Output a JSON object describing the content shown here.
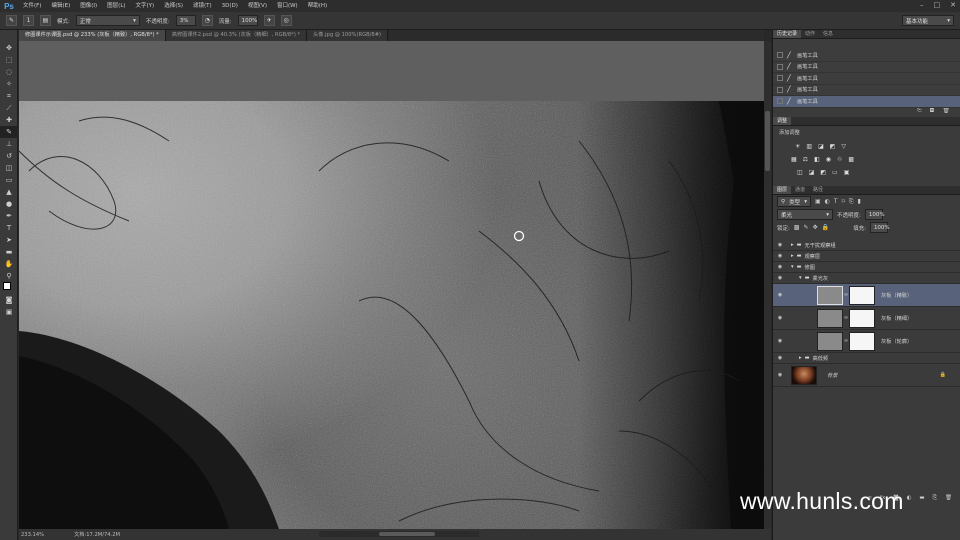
{
  "app": {
    "logo": "Ps"
  },
  "menubar": {
    "items": [
      "文件(F)",
      "编辑(E)",
      "图像(I)",
      "图层(L)",
      "文字(Y)",
      "选择(S)",
      "滤镜(T)",
      "3D(D)",
      "视图(V)",
      "窗口(W)",
      "帮助(H)"
    ]
  },
  "window_controls": {
    "minimize": "–",
    "maximize": "□",
    "close": "✕"
  },
  "options": {
    "brush_size": "1",
    "mode_label": "模式:",
    "mode_value": "正常",
    "opacity_label": "不透明度:",
    "opacity_value": "3%",
    "flow_label": "流量:",
    "flow_value": "100%",
    "workspace": "基本功能"
  },
  "doc_tabs": [
    "修图课件示课图.psd @ 233% (灰板（精致）, RGB/8*) *",
    "高修图课件2.psd @ 40.3% (灰板（精细）, RGB/8*) *",
    "头像.jpg @ 100%(RGB/8#)"
  ],
  "status": {
    "zoom": "233.14%",
    "doc_size": "文档:17.2M/74.2M"
  },
  "history": {
    "tabs": [
      "历史记录",
      "动作",
      "信息"
    ],
    "items": [
      "画笔工具",
      "画笔工具",
      "画笔工具",
      "画笔工具",
      "画笔工具"
    ]
  },
  "adjustments": {
    "tab": "调整",
    "add_label": "添加调整"
  },
  "layers": {
    "tabs": [
      "图层",
      "通道",
      "路径"
    ],
    "filter_kind": "类型",
    "blend_mode": "柔光",
    "opacity_label": "不透明度:",
    "opacity_value": "100%",
    "lock_label": "锁定:",
    "fill_label": "填充:",
    "fill_value": "100%",
    "rows": [
      {
        "name": "无干扰观察组",
        "kind": "group"
      },
      {
        "name": "观察层",
        "kind": "group"
      },
      {
        "name": "修图",
        "kind": "group-open"
      },
      {
        "name": "柔光灰",
        "kind": "group-open"
      },
      {
        "name": "灰板（精致）",
        "kind": "layer"
      },
      {
        "name": "灰板（精细）",
        "kind": "layer"
      },
      {
        "name": "灰板（轮廓）",
        "kind": "layer"
      },
      {
        "name": "高低频",
        "kind": "group"
      },
      {
        "name": "背景",
        "kind": "background"
      }
    ]
  },
  "watermark": "www.hunls.com"
}
